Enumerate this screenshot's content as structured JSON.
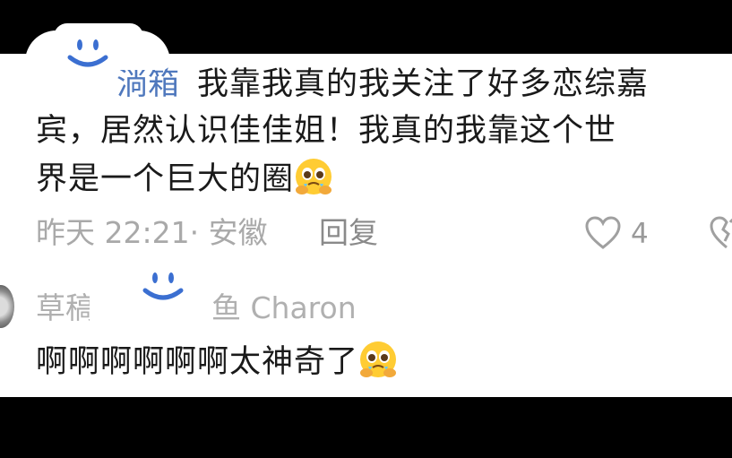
{
  "comment1": {
    "username": "淌箱",
    "line1": "我靠我真的我关注了好多恋综嘉",
    "line2": "宾，居然认识佳佳姐！我真的我靠这个世",
    "line3": "界是一个巨大的圈",
    "emoji": "pleading-face-emoji",
    "timestamp": "昨天 22:21· 安徽",
    "reply_label": "回复",
    "like_count": "4"
  },
  "comment2": {
    "username_prefix": "草稿",
    "username_suffix": "鱼 Charon",
    "text": "啊啊啊啊啊啊太神奇了",
    "emoji": "pleading-face-emoji"
  },
  "colors": {
    "background": "#000000",
    "panel": "#ffffff",
    "username": "#4f78bd",
    "meta": "#a9a9a9",
    "smiley": "#3b6fd1"
  }
}
